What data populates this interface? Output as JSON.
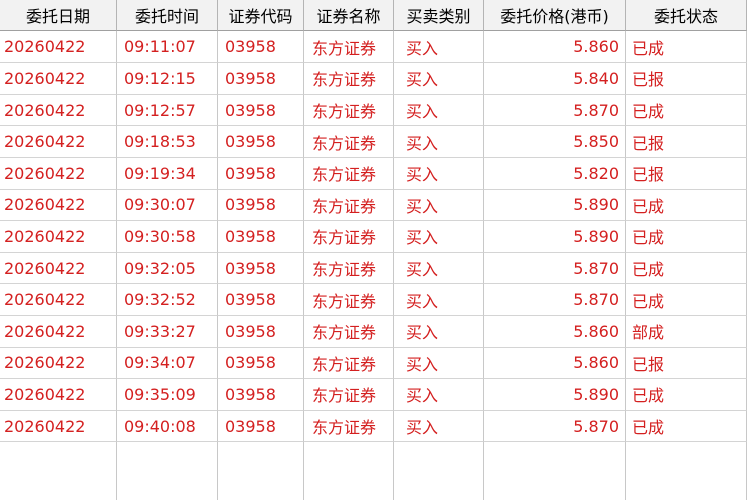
{
  "columns": [
    "委托日期",
    "委托时间",
    "证券代码",
    "证券名称",
    "买卖类别",
    "委托价格(港币)",
    "委托状态"
  ],
  "rows": [
    {
      "date": "20260422",
      "time": "09:11:07",
      "code": "03958",
      "name": "东方证券",
      "side": "买入",
      "price": "5.860",
      "status": "已成"
    },
    {
      "date": "20260422",
      "time": "09:12:15",
      "code": "03958",
      "name": "东方证券",
      "side": "买入",
      "price": "5.840",
      "status": "已报"
    },
    {
      "date": "20260422",
      "time": "09:12:57",
      "code": "03958",
      "name": "东方证券",
      "side": "买入",
      "price": "5.870",
      "status": "已成"
    },
    {
      "date": "20260422",
      "time": "09:18:53",
      "code": "03958",
      "name": "东方证券",
      "side": "买入",
      "price": "5.850",
      "status": "已报"
    },
    {
      "date": "20260422",
      "time": "09:19:34",
      "code": "03958",
      "name": "东方证券",
      "side": "买入",
      "price": "5.820",
      "status": "已报"
    },
    {
      "date": "20260422",
      "time": "09:30:07",
      "code": "03958",
      "name": "东方证券",
      "side": "买入",
      "price": "5.890",
      "status": "已成"
    },
    {
      "date": "20260422",
      "time": "09:30:58",
      "code": "03958",
      "name": "东方证券",
      "side": "买入",
      "price": "5.890",
      "status": "已成"
    },
    {
      "date": "20260422",
      "time": "09:32:05",
      "code": "03958",
      "name": "东方证券",
      "side": "买入",
      "price": "5.870",
      "status": "已成"
    },
    {
      "date": "20260422",
      "time": "09:32:52",
      "code": "03958",
      "name": "东方证券",
      "side": "买入",
      "price": "5.870",
      "status": "已成"
    },
    {
      "date": "20260422",
      "time": "09:33:27",
      "code": "03958",
      "name": "东方证券",
      "side": "买入",
      "price": "5.860",
      "status": "部成"
    },
    {
      "date": "20260422",
      "time": "09:34:07",
      "code": "03958",
      "name": "东方证券",
      "side": "买入",
      "price": "5.860",
      "status": "已报"
    },
    {
      "date": "20260422",
      "time": "09:35:09",
      "code": "03958",
      "name": "东方证券",
      "side": "买入",
      "price": "5.890",
      "status": "已成"
    },
    {
      "date": "20260422",
      "time": "09:40:08",
      "code": "03958",
      "name": "东方证券",
      "side": "买入",
      "price": "5.870",
      "status": "已成"
    }
  ],
  "colors": {
    "text_red": "#d42020",
    "header_bg": "#f2f2f2"
  }
}
